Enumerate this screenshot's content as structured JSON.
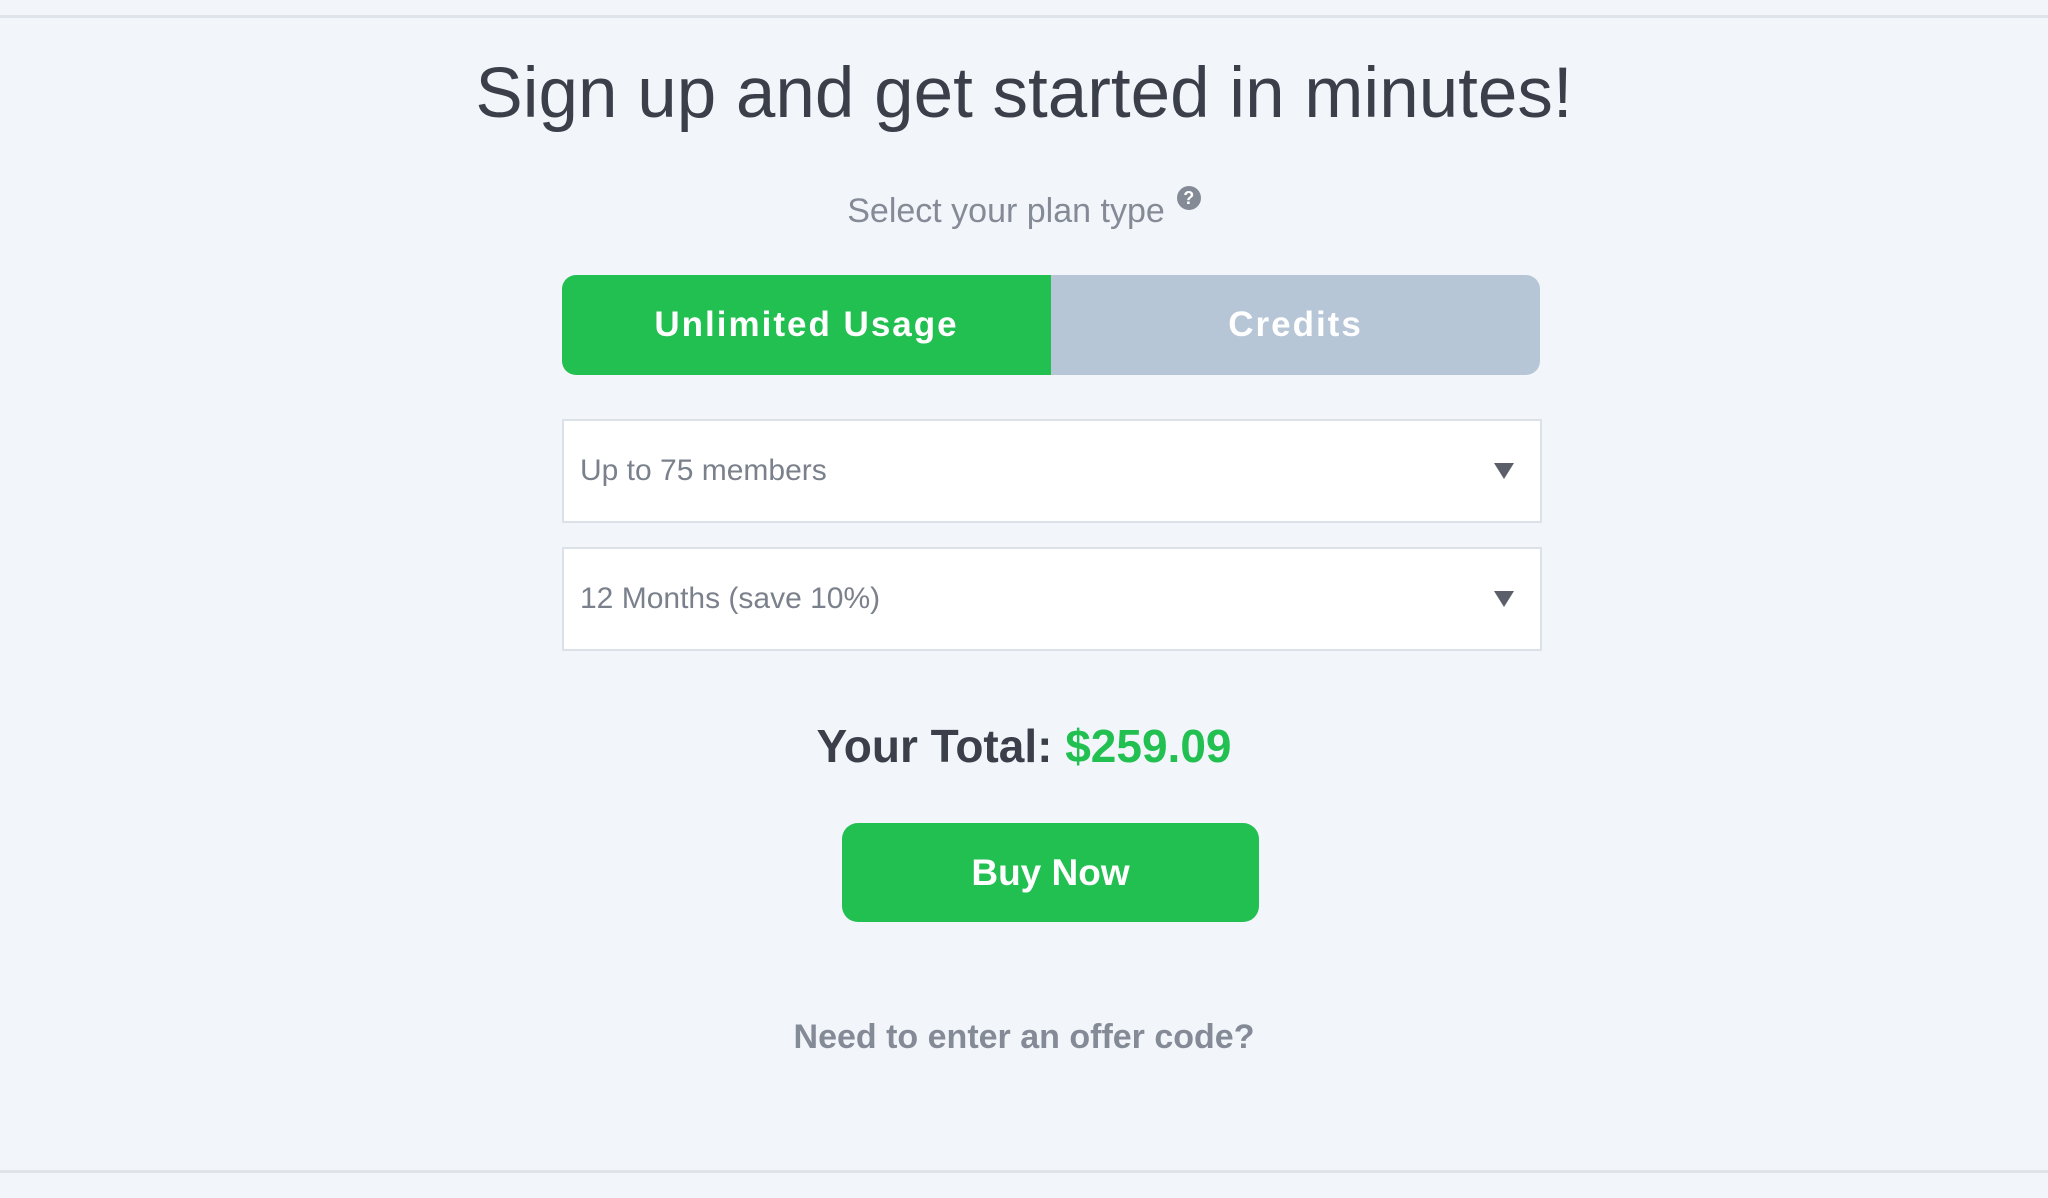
{
  "page": {
    "headline": "Sign up and get started in minutes!",
    "plan_type_label": "Select your plan type",
    "help_icon_glyph": "?"
  },
  "plan_toggle": {
    "options": [
      {
        "label": "Unlimited Usage",
        "selected": true
      },
      {
        "label": "Credits",
        "selected": false
      }
    ]
  },
  "selects": {
    "members": {
      "value": "Up to 75 members"
    },
    "duration": {
      "value": "12 Months (save 10%)"
    }
  },
  "total": {
    "label": "Your Total:",
    "amount": "$259.09"
  },
  "buttons": {
    "buy_now": "Buy Now"
  },
  "links": {
    "offer_code": "Need to enter an offer code?"
  },
  "colors": {
    "accent_green": "#22bf51",
    "inactive_toggle": "#b6c6d6",
    "background": "#f2f6fb",
    "heading_text": "#3a3f4a",
    "muted_text": "#858b96"
  },
  "icons": {
    "help": "question-circle-icon",
    "dropdown": "caret-down-icon"
  }
}
